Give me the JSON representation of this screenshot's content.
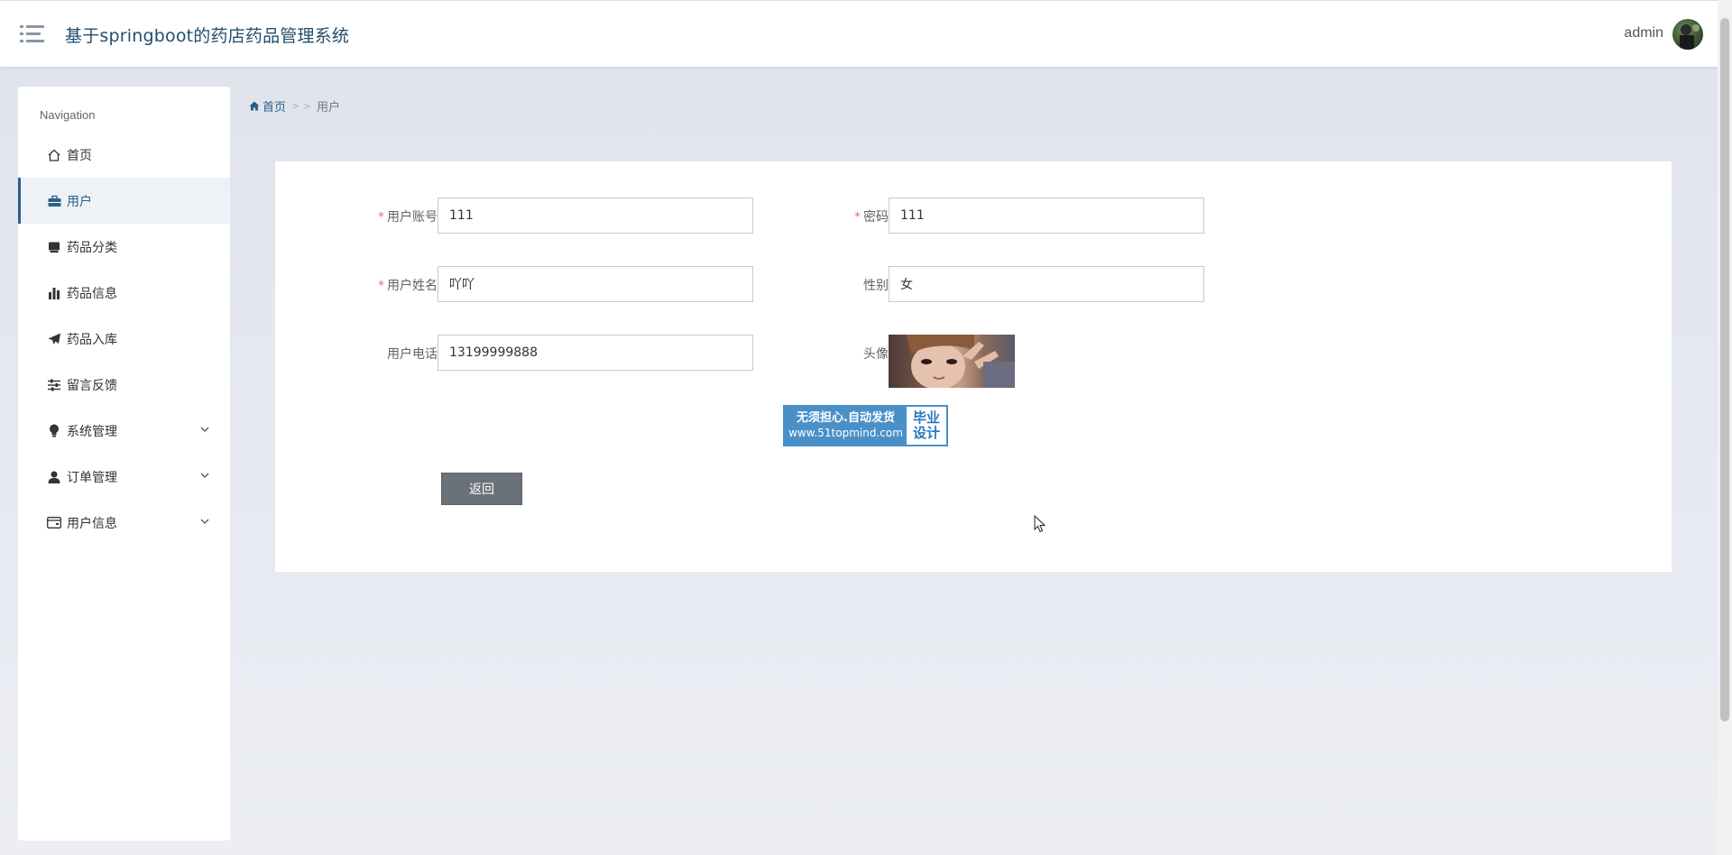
{
  "header": {
    "title": "基于springboot的药店药品管理系统",
    "user": "admin"
  },
  "sidebar": {
    "heading": "Navigation",
    "items": [
      {
        "label": "首页",
        "icon": "home-icon"
      },
      {
        "label": "用户",
        "icon": "briefcase-icon",
        "active": true
      },
      {
        "label": "药品分类",
        "icon": "inbox-icon"
      },
      {
        "label": "药品信息",
        "icon": "bar-chart-icon"
      },
      {
        "label": "药品入库",
        "icon": "send-icon"
      },
      {
        "label": "留言反馈",
        "icon": "sliders-icon"
      },
      {
        "label": "系统管理",
        "icon": "bulb-icon",
        "expandable": true
      },
      {
        "label": "订单管理",
        "icon": "user-icon",
        "expandable": true
      },
      {
        "label": "用户信息",
        "icon": "card-icon",
        "expandable": true
      }
    ]
  },
  "breadcrumb": {
    "home": "首页",
    "separator": "> >",
    "current": "用户"
  },
  "form": {
    "account": {
      "label": "用户账号",
      "value": "111",
      "required": true
    },
    "password": {
      "label": "密码",
      "value": "111",
      "required": true
    },
    "name": {
      "label": "用户姓名",
      "value": "吖吖",
      "required": true
    },
    "gender": {
      "label": "性别",
      "value": "女"
    },
    "phone": {
      "label": "用户电话",
      "value": "13199999888"
    },
    "avatar": {
      "label": "头像"
    },
    "back_label": "返回"
  },
  "watermark": {
    "line1": "无须担心.自动发货",
    "line2": "www.51topmind.com",
    "right1": "毕业",
    "right2": "设计"
  },
  "colors": {
    "accent": "#2d5f86",
    "required": "#f56c6c",
    "button": "#6a7178"
  }
}
